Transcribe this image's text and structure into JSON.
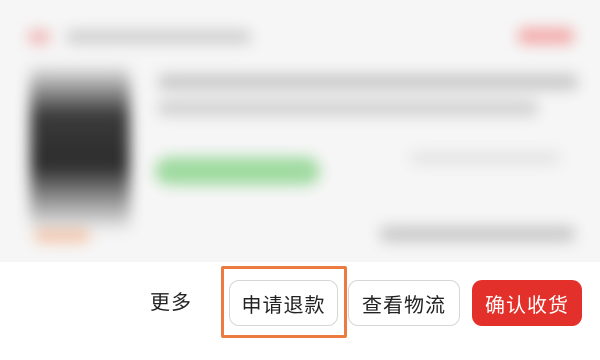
{
  "actions": {
    "more_label": "更多",
    "refund_label": "申请退款",
    "logistics_label": "查看物流",
    "confirm_label": "确认收货"
  },
  "colors": {
    "primary_button": "#e3302a",
    "highlight_outline": "#ec7b41",
    "outline_button_border": "#d6d6d6"
  }
}
